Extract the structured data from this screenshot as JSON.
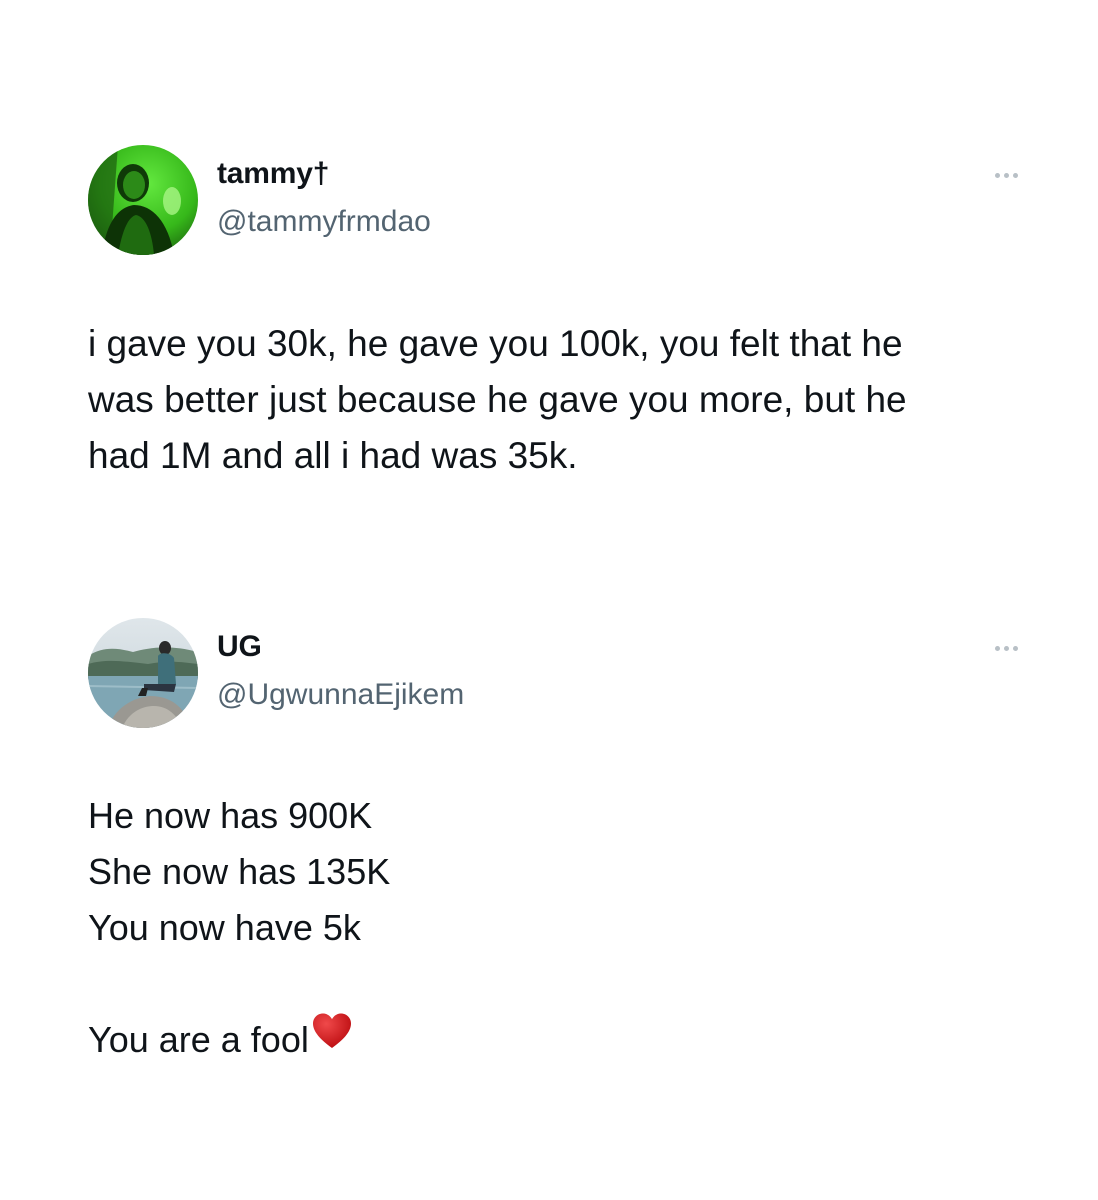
{
  "colors": {
    "background": "#ffffff",
    "text_primary": "#0f1419",
    "text_secondary": "#536471",
    "more_dots": "#b8c0c6",
    "avatar_1_tint": "#3ec81e",
    "heart": "#d0191c"
  },
  "tweets": [
    {
      "author": {
        "display_name": "tammy†",
        "handle": "@tammyfrmdao",
        "avatar": "green-tinted-profile-photo"
      },
      "more_icon": "more-horizontal-icon",
      "text_lines": [
        "i gave you 30k, he gave you 100k, you felt that he",
        "was better just because he gave you more, but he",
        "had 1M and all i had was 35k."
      ]
    },
    {
      "author": {
        "display_name": "UG",
        "handle": "@UgwunnaEjikem",
        "avatar": "person-sitting-on-rock-by-water-photo"
      },
      "more_icon": "more-horizontal-icon",
      "text_lines": [
        "He now has 900K",
        "She now has 135K",
        "You now have 5k",
        "",
        "You are a fool"
      ],
      "trailing_emoji": "red-heart-icon"
    }
  ]
}
